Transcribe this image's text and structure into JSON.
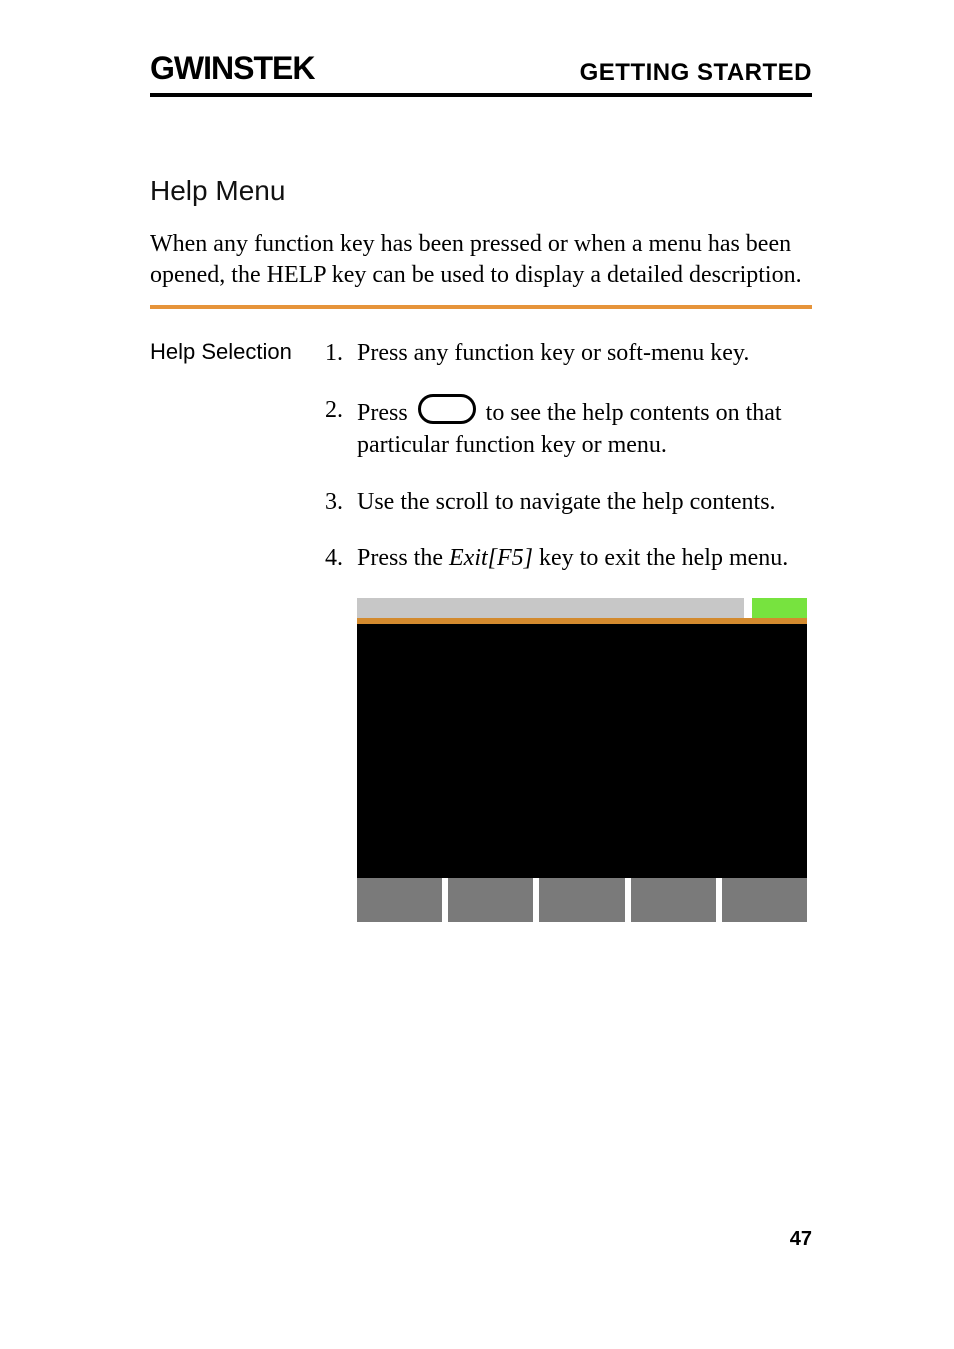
{
  "brand": "GWINSTEK",
  "chapterTitle": "GETTING STARTED",
  "sectionTitle": "Help Menu",
  "intro": "When any function key has been pressed or when a menu has been opened, the HELP key can be used to display a detailed description.",
  "leftLabel": "Help Selection",
  "steps": {
    "s1_num": "1.",
    "s1_text": "Press any function key or soft-menu key.",
    "s2_num": "2.",
    "s2_prefix": "Press",
    "s2_suffix": "to see the help contents on that particular function key or menu.",
    "s3_num": "3.",
    "s3_text": "Use the scroll to navigate the help contents.",
    "s4_num": "4.",
    "s4_prefix": "Press the ",
    "s4_italic": "Exit[F5]",
    "s4_suffix": " key to exit the help menu."
  },
  "pageNumber": "47"
}
